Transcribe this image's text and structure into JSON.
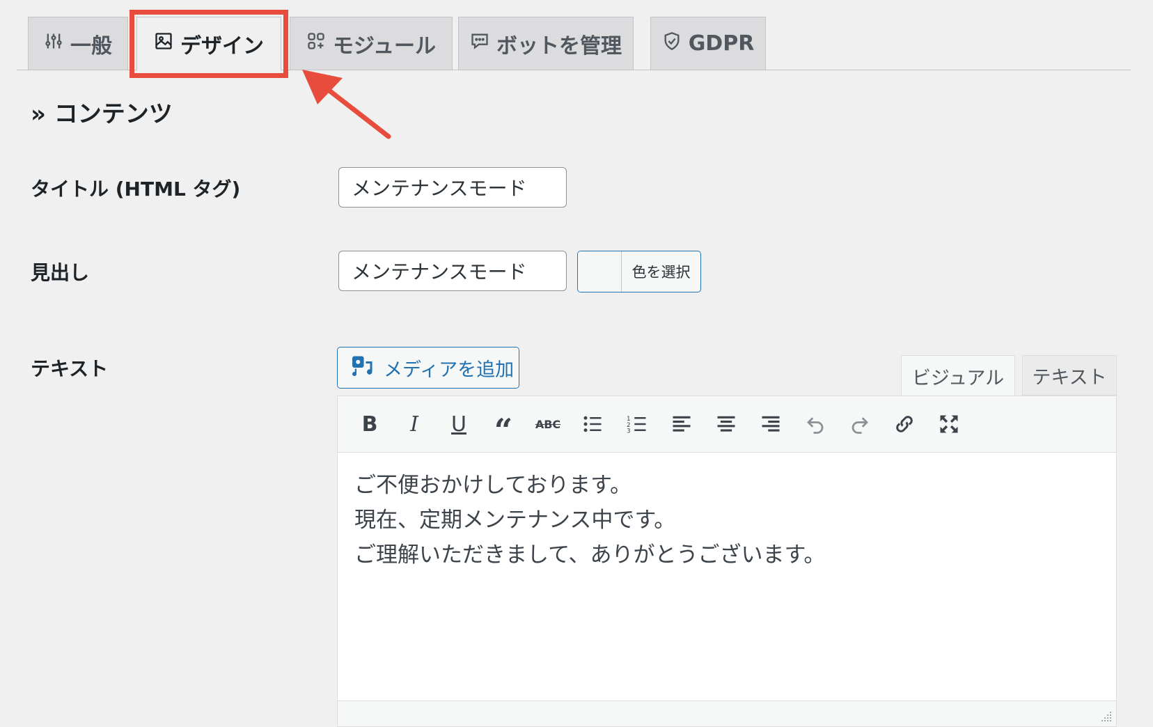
{
  "tabs": [
    {
      "label": "一般",
      "icon": "sliders-icon",
      "active": false
    },
    {
      "label": "デザイン",
      "icon": "image-icon",
      "active": true
    },
    {
      "label": "モジュール",
      "icon": "modules-icon",
      "active": false
    },
    {
      "label": "ボットを管理",
      "icon": "chat-icon",
      "active": false
    },
    {
      "label": "GDPR",
      "icon": "shield-icon",
      "active": false
    }
  ],
  "section_title": "» コンテンツ",
  "fields": {
    "title_label": "タイトル (HTML タグ)",
    "title_value": "メンテナンスモード",
    "heading_label": "見出し",
    "heading_value": "メンテナンスモード",
    "color_button": "色を選択",
    "text_label": "テキスト"
  },
  "editor": {
    "add_media": "メディアを追加",
    "tab_visual": "ビジュアル",
    "tab_text": "テキスト",
    "toolbar": [
      "bold",
      "italic",
      "underline",
      "blockquote",
      "strikethrough",
      "bullet-list",
      "numbered-list",
      "align-left",
      "align-center",
      "align-right",
      "undo",
      "redo",
      "link",
      "fullscreen"
    ],
    "lines": [
      "ご不便おかけしております。",
      "現在、定期メンテナンス中です。",
      "ご理解いただきまして、ありがとうございます。"
    ]
  },
  "colors": {
    "accent": "#2271b1",
    "highlight": "#e74c3c"
  }
}
